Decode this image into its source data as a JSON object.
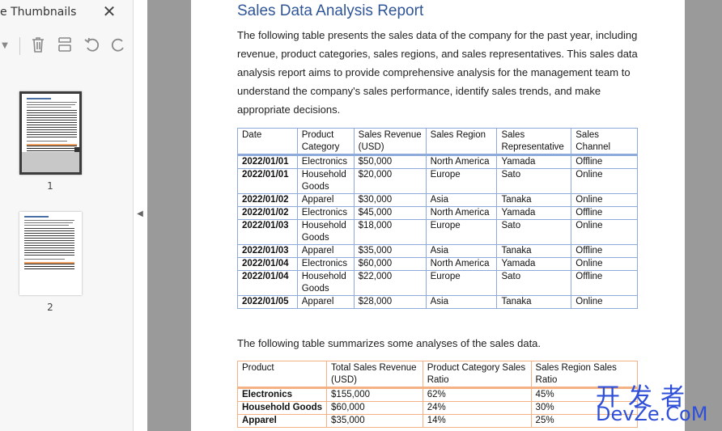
{
  "sidebar": {
    "title": "e Thumbnails",
    "toolbar": {
      "dropdown_icon": "caret-down-icon",
      "delete_icon": "trash-icon",
      "extract_icon": "extract-pages-icon",
      "rotate_left_icon": "rotate-left-icon",
      "rotate_right_icon": "rotate-right-icon"
    },
    "thumbnails": [
      {
        "label": "1",
        "selected": true
      },
      {
        "label": "2",
        "selected": false
      }
    ]
  },
  "document": {
    "title": "Sales Data Analysis Report",
    "intro": "The following table presents the sales data of the company for the past year, including revenue, product categories, sales regions, and sales representatives. This sales data analysis report aims to provide comprehensive analysis for the management team to understand the company's sales performance, identify sales trends, and make appropriate decisions.",
    "sales_table": {
      "headers": [
        "Date",
        "Product Category",
        "Sales Revenue (USD)",
        "Sales Region",
        "Sales Representative",
        "Sales Channel"
      ],
      "rows": [
        [
          "2022/01/01",
          "Electronics",
          "$50,000",
          "North America",
          "Yamada",
          "Offline"
        ],
        [
          "2022/01/01",
          "Household Goods",
          "$20,000",
          "Europe",
          "Sato",
          "Online"
        ],
        [
          "2022/01/02",
          "Apparel",
          "$30,000",
          "Asia",
          "Tanaka",
          "Online"
        ],
        [
          "2022/01/02",
          "Electronics",
          "$45,000",
          "North America",
          "Yamada",
          "Offline"
        ],
        [
          "2022/01/03",
          "Household Goods",
          "$18,000",
          "Europe",
          "Sato",
          "Online"
        ],
        [
          "2022/01/03",
          "Apparel",
          "$35,000",
          "Asia",
          "Tanaka",
          "Offline"
        ],
        [
          "2022/01/04",
          "Electronics",
          "$60,000",
          "North America",
          "Yamada",
          "Online"
        ],
        [
          "2022/01/04",
          "Household Goods",
          "$22,000",
          "Europe",
          "Sato",
          "Offline"
        ],
        [
          "2022/01/05",
          "Apparel",
          "$28,000",
          "Asia",
          "Tanaka",
          "Online"
        ]
      ]
    },
    "summary_intro": "The following table summarizes some analyses of the sales data.",
    "summary_table": {
      "headers": [
        "Product",
        "Total Sales Revenue (USD)",
        "Product Category Sales Ratio",
        "Sales Region Sales Ratio"
      ],
      "rows": [
        [
          "Electronics",
          "$155,000",
          "62%",
          "45%"
        ],
        [
          "Household Goods",
          "$60,000",
          "24%",
          "30%"
        ],
        [
          "Apparel",
          "$35,000",
          "14%",
          "25%"
        ]
      ]
    }
  },
  "watermark": {
    "line1": "开发者",
    "line2": "DevZe.CoM"
  },
  "colors": {
    "title": "#2f5597",
    "sales_table_border": "#8eaadb",
    "summary_table_border": "#f4b183",
    "viewer_bg": "#9a9a9a",
    "watermark": "#2f4fd8"
  }
}
